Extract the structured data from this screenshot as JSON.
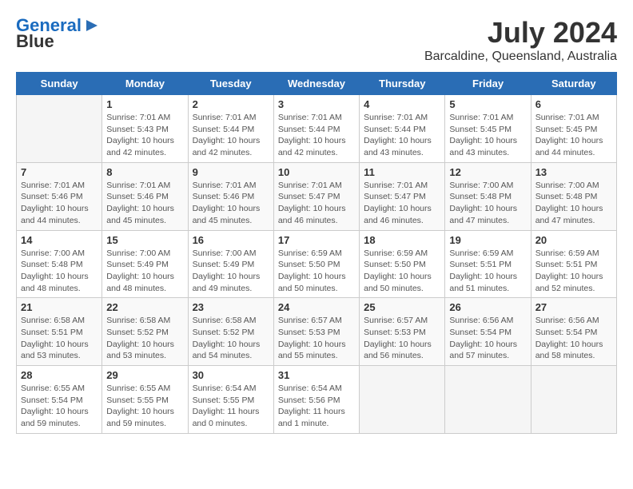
{
  "header": {
    "logo_line1": "General",
    "logo_line2": "Blue",
    "title": "July 2024",
    "subtitle": "Barcaldine, Queensland, Australia"
  },
  "days_of_week": [
    "Sunday",
    "Monday",
    "Tuesday",
    "Wednesday",
    "Thursday",
    "Friday",
    "Saturday"
  ],
  "weeks": [
    [
      {
        "day": "",
        "detail": ""
      },
      {
        "day": "1",
        "detail": "Sunrise: 7:01 AM\nSunset: 5:43 PM\nDaylight: 10 hours\nand 42 minutes."
      },
      {
        "day": "2",
        "detail": "Sunrise: 7:01 AM\nSunset: 5:44 PM\nDaylight: 10 hours\nand 42 minutes."
      },
      {
        "day": "3",
        "detail": "Sunrise: 7:01 AM\nSunset: 5:44 PM\nDaylight: 10 hours\nand 42 minutes."
      },
      {
        "day": "4",
        "detail": "Sunrise: 7:01 AM\nSunset: 5:44 PM\nDaylight: 10 hours\nand 43 minutes."
      },
      {
        "day": "5",
        "detail": "Sunrise: 7:01 AM\nSunset: 5:45 PM\nDaylight: 10 hours\nand 43 minutes."
      },
      {
        "day": "6",
        "detail": "Sunrise: 7:01 AM\nSunset: 5:45 PM\nDaylight: 10 hours\nand 44 minutes."
      }
    ],
    [
      {
        "day": "7",
        "detail": "Sunrise: 7:01 AM\nSunset: 5:46 PM\nDaylight: 10 hours\nand 44 minutes."
      },
      {
        "day": "8",
        "detail": "Sunrise: 7:01 AM\nSunset: 5:46 PM\nDaylight: 10 hours\nand 45 minutes."
      },
      {
        "day": "9",
        "detail": "Sunrise: 7:01 AM\nSunset: 5:46 PM\nDaylight: 10 hours\nand 45 minutes."
      },
      {
        "day": "10",
        "detail": "Sunrise: 7:01 AM\nSunset: 5:47 PM\nDaylight: 10 hours\nand 46 minutes."
      },
      {
        "day": "11",
        "detail": "Sunrise: 7:01 AM\nSunset: 5:47 PM\nDaylight: 10 hours\nand 46 minutes."
      },
      {
        "day": "12",
        "detail": "Sunrise: 7:00 AM\nSunset: 5:48 PM\nDaylight: 10 hours\nand 47 minutes."
      },
      {
        "day": "13",
        "detail": "Sunrise: 7:00 AM\nSunset: 5:48 PM\nDaylight: 10 hours\nand 47 minutes."
      }
    ],
    [
      {
        "day": "14",
        "detail": "Sunrise: 7:00 AM\nSunset: 5:48 PM\nDaylight: 10 hours\nand 48 minutes."
      },
      {
        "day": "15",
        "detail": "Sunrise: 7:00 AM\nSunset: 5:49 PM\nDaylight: 10 hours\nand 48 minutes."
      },
      {
        "day": "16",
        "detail": "Sunrise: 7:00 AM\nSunset: 5:49 PM\nDaylight: 10 hours\nand 49 minutes."
      },
      {
        "day": "17",
        "detail": "Sunrise: 6:59 AM\nSunset: 5:50 PM\nDaylight: 10 hours\nand 50 minutes."
      },
      {
        "day": "18",
        "detail": "Sunrise: 6:59 AM\nSunset: 5:50 PM\nDaylight: 10 hours\nand 50 minutes."
      },
      {
        "day": "19",
        "detail": "Sunrise: 6:59 AM\nSunset: 5:51 PM\nDaylight: 10 hours\nand 51 minutes."
      },
      {
        "day": "20",
        "detail": "Sunrise: 6:59 AM\nSunset: 5:51 PM\nDaylight: 10 hours\nand 52 minutes."
      }
    ],
    [
      {
        "day": "21",
        "detail": "Sunrise: 6:58 AM\nSunset: 5:51 PM\nDaylight: 10 hours\nand 53 minutes."
      },
      {
        "day": "22",
        "detail": "Sunrise: 6:58 AM\nSunset: 5:52 PM\nDaylight: 10 hours\nand 53 minutes."
      },
      {
        "day": "23",
        "detail": "Sunrise: 6:58 AM\nSunset: 5:52 PM\nDaylight: 10 hours\nand 54 minutes."
      },
      {
        "day": "24",
        "detail": "Sunrise: 6:57 AM\nSunset: 5:53 PM\nDaylight: 10 hours\nand 55 minutes."
      },
      {
        "day": "25",
        "detail": "Sunrise: 6:57 AM\nSunset: 5:53 PM\nDaylight: 10 hours\nand 56 minutes."
      },
      {
        "day": "26",
        "detail": "Sunrise: 6:56 AM\nSunset: 5:54 PM\nDaylight: 10 hours\nand 57 minutes."
      },
      {
        "day": "27",
        "detail": "Sunrise: 6:56 AM\nSunset: 5:54 PM\nDaylight: 10 hours\nand 58 minutes."
      }
    ],
    [
      {
        "day": "28",
        "detail": "Sunrise: 6:55 AM\nSunset: 5:54 PM\nDaylight: 10 hours\nand 59 minutes."
      },
      {
        "day": "29",
        "detail": "Sunrise: 6:55 AM\nSunset: 5:55 PM\nDaylight: 10 hours\nand 59 minutes."
      },
      {
        "day": "30",
        "detail": "Sunrise: 6:54 AM\nSunset: 5:55 PM\nDaylight: 11 hours\nand 0 minutes."
      },
      {
        "day": "31",
        "detail": "Sunrise: 6:54 AM\nSunset: 5:56 PM\nDaylight: 11 hours\nand 1 minute."
      },
      {
        "day": "",
        "detail": ""
      },
      {
        "day": "",
        "detail": ""
      },
      {
        "day": "",
        "detail": ""
      }
    ]
  ]
}
